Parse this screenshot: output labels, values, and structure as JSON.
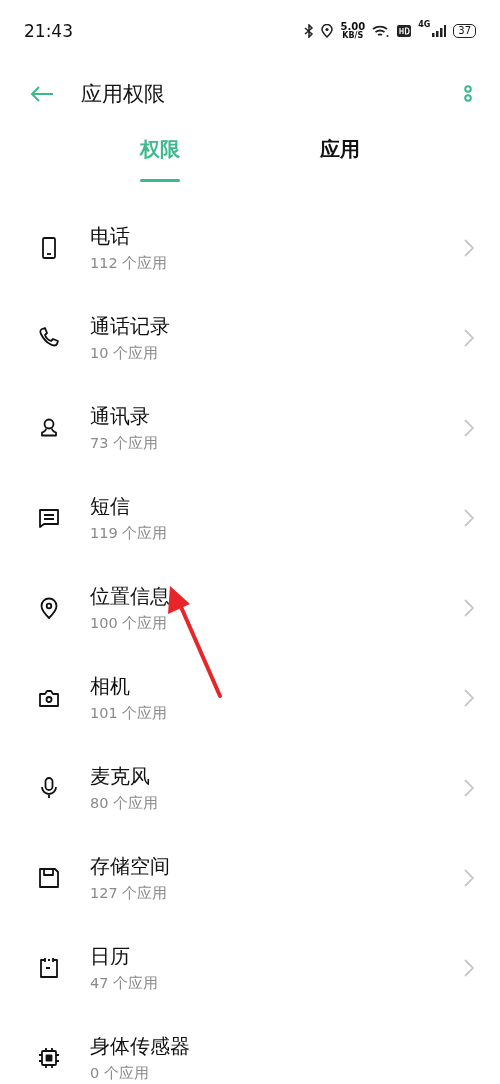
{
  "status_bar": {
    "time": "21:43",
    "speed_value": "5.00",
    "speed_unit": "KB/S",
    "network": "4G",
    "battery": "37"
  },
  "header": {
    "title": "应用权限"
  },
  "tabs": [
    {
      "label": "权限",
      "selected": true
    },
    {
      "label": "应用",
      "selected": false
    }
  ],
  "permissions": [
    {
      "kind": "phone",
      "title": "电话",
      "count": "112 个应用",
      "chevron": true
    },
    {
      "kind": "call",
      "title": "通话记录",
      "count": "10 个应用",
      "chevron": true
    },
    {
      "kind": "contact",
      "title": "通讯录",
      "count": "73 个应用",
      "chevron": true
    },
    {
      "kind": "message",
      "title": "短信",
      "count": "119 个应用",
      "chevron": true
    },
    {
      "kind": "location",
      "title": "位置信息",
      "count": "100 个应用",
      "chevron": true
    },
    {
      "kind": "camera",
      "title": "相机",
      "count": "101 个应用",
      "chevron": true
    },
    {
      "kind": "mic",
      "title": "麦克风",
      "count": "80 个应用",
      "chevron": true
    },
    {
      "kind": "storage",
      "title": "存储空间",
      "count": "127 个应用",
      "chevron": true
    },
    {
      "kind": "calendar",
      "title": "日历",
      "count": "47 个应用",
      "chevron": true
    },
    {
      "kind": "sensor",
      "title": "身体传感器",
      "count": "0 个应用",
      "chevron": false
    }
  ],
  "annotations": [
    {
      "kind": "arrow",
      "color": "#e8262a"
    }
  ]
}
